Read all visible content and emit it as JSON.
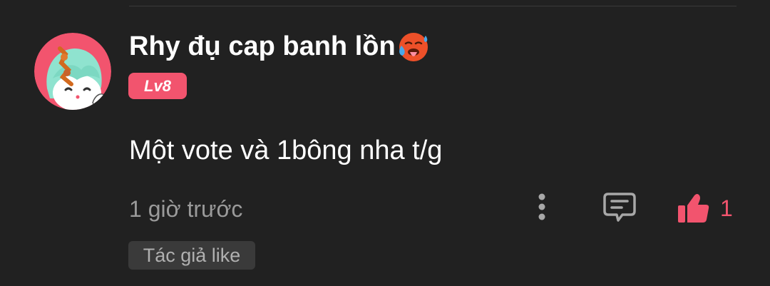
{
  "comment": {
    "username": "Rhy đụ cap banh lồn",
    "username_emoji": "hot-face-emoji",
    "level_badge": "Lv8",
    "text": "Một vote và 1bông nha t/g",
    "timestamp": "1 giờ trước",
    "like_count": "1",
    "author_like_label": "Tác giả like"
  },
  "icons": {
    "more": "more-vertical-icon",
    "reply": "comment-bubble-icon",
    "like": "thumbs-up-icon"
  },
  "colors": {
    "background": "#212121",
    "accent": "#f2546e",
    "text_primary": "#ffffff",
    "text_secondary": "#9a9a9a",
    "chip_background": "#3a3a3a"
  }
}
